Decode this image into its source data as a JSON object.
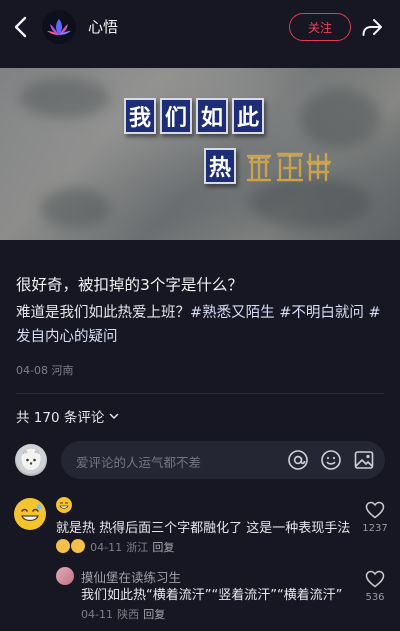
{
  "header": {
    "author": "心悟",
    "follow_label": "关注",
    "icons": [
      "back-arrow-icon",
      "lotus-avatar",
      "share-icon"
    ]
  },
  "image": {
    "sign_line1": [
      "我",
      "们",
      "如",
      "此"
    ],
    "sign_line2_visible": "热",
    "sign_line2_hidden": "爱上班"
  },
  "post": {
    "title": "很好奇，被扣掉的3个字是什么？",
    "body_text": "难道是我们如此热爱上班？",
    "tags": [
      "#熟悉又陌生",
      "#不明白就问",
      "#发自内心的疑问"
    ],
    "date": "04-08",
    "location": "河南"
  },
  "comments_summary": {
    "count_label": "共 170 条评论"
  },
  "comment_input": {
    "placeholder": "爱评论的人运气都不差",
    "icons": [
      "at-icon",
      "emoji-icon",
      "image-icon"
    ]
  },
  "comments": [
    {
      "text": "就是热 热得后面三个字都融化了 这是一种表现手法",
      "date": "04-11",
      "location": "浙江",
      "reply_label": "回复",
      "likes": "1237"
    }
  ],
  "reply": {
    "author": "摸仙堡在读练习生",
    "text": "我们如此热“横着流汗”“竖着流汗”“横着流汗”",
    "date": "04-11",
    "location": "陕西",
    "reply_label": "回复",
    "likes": "536"
  },
  "colors": {
    "background": "#161722",
    "accent": "#f0415a",
    "tag": "#d7ddf5"
  }
}
